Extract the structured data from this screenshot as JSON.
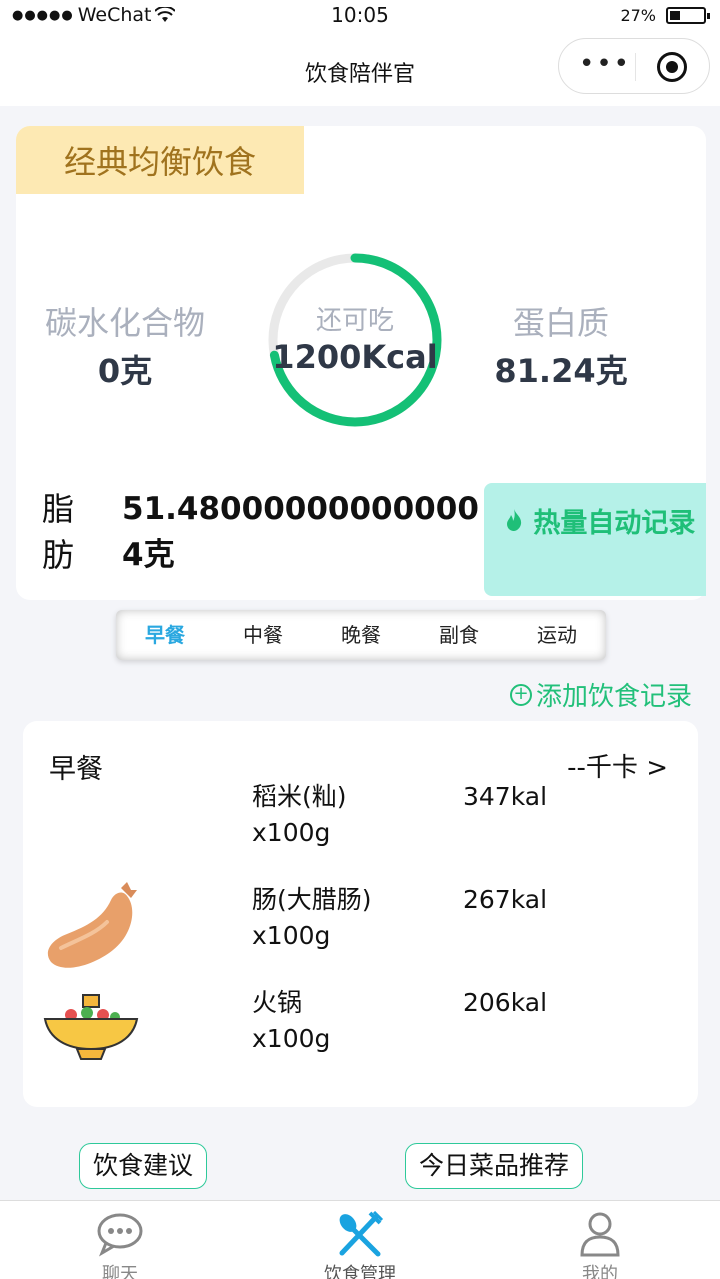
{
  "status_bar": {
    "carrier": "WeChat",
    "time": "10:05",
    "battery": "27%",
    "battery_level": 0.27
  },
  "nav": {
    "title": "饮食陪伴官"
  },
  "summary": {
    "diet_type": "经典均衡饮食",
    "carbs": {
      "label": "碳水化合物",
      "value": "0克"
    },
    "remaining": {
      "label": "还可吃",
      "value": "1200Kcal",
      "progress": 0.72
    },
    "protein": {
      "label": "蛋白质",
      "value": "81.24克"
    },
    "fat": {
      "label": "脂肪",
      "value": "51.480000000000004克"
    },
    "auto_record_label": "热量自动记录"
  },
  "meal_tabs": [
    "早餐",
    "中餐",
    "晚餐",
    "副食",
    "运动"
  ],
  "active_tab": 0,
  "add_record_label": "添加饮食记录",
  "meal": {
    "title": "早餐",
    "kcal_summary": "--千卡 >",
    "foods": [
      {
        "name": "稻米(籼)",
        "amount": "x100g",
        "kcal": "347kal",
        "icon": "none"
      },
      {
        "name": "肠(大腊肠)",
        "amount": "x100g",
        "kcal": "267kal",
        "icon": "sausage-icon"
      },
      {
        "name": "火锅",
        "amount": "x100g",
        "kcal": "206kal",
        "icon": "hotpot-icon"
      }
    ]
  },
  "buttons": {
    "diet_advice": "饮食建议",
    "daily_recommend": "今日菜品推荐"
  },
  "tabbar": [
    {
      "label": "聊天",
      "icon": "chat-icon"
    },
    {
      "label": "饮食管理",
      "icon": "fork-spoon-icon"
    },
    {
      "label": "我的",
      "icon": "user-icon"
    }
  ],
  "colors": {
    "accent_green": "#22c07a",
    "accent_blue": "#2aa8e0",
    "tag_bg": "#fde9b3"
  }
}
